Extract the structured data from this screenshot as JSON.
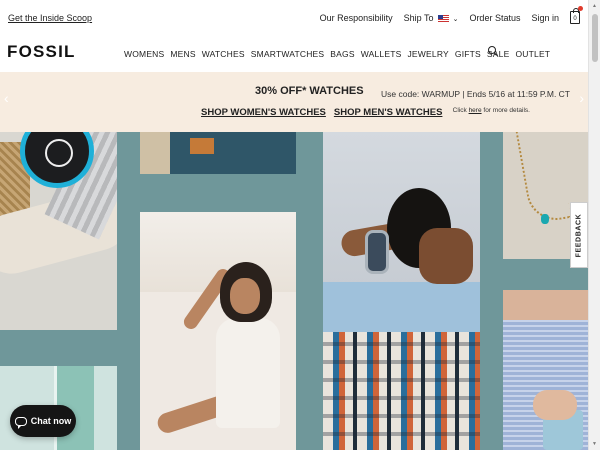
{
  "utility_bar": {
    "scoop_link": "Get the Inside Scoop",
    "responsibility": "Our Responsibility",
    "ship_to": "Ship To",
    "order_status": "Order Status",
    "sign_in": "Sign in",
    "cart_count": "0"
  },
  "nav": {
    "logo": "FOSSIL",
    "items": [
      "WOMENS",
      "MENS",
      "WATCHES",
      "SMARTWATCHES",
      "BAGS",
      "WALLETS",
      "JEWELRY",
      "GIFTS",
      "SALE",
      "OUTLET"
    ]
  },
  "promo": {
    "title": "30% OFF* WATCHES",
    "link_women": "SHOP WOMEN'S WATCHES",
    "link_men": "SHOP MEN'S WATCHES",
    "code_text": "Use code: WARMUP | Ends 5/16 at 11:59 P.M. CT",
    "details_prefix": "Click",
    "details_link": "here",
    "details_suffix": "for more details."
  },
  "feedback_label": "FEEDBACK",
  "chat_label": "Chat now"
}
